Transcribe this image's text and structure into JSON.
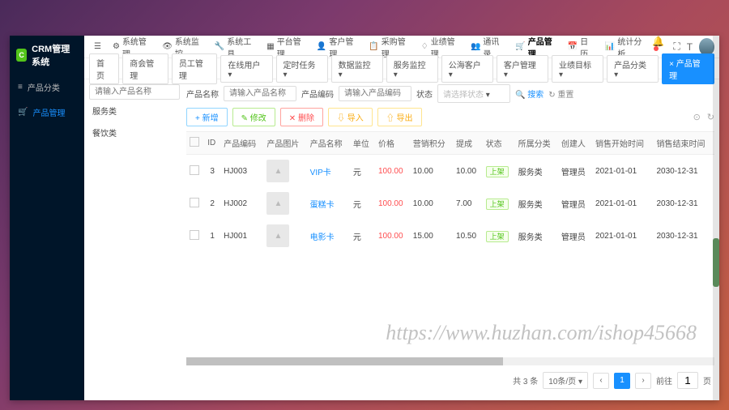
{
  "brand": {
    "title": "CRM管理系统",
    "badge": "C"
  },
  "sidebar": {
    "items": [
      {
        "icon": "list",
        "label": "产品分类"
      },
      {
        "icon": "cart",
        "label": "产品管理"
      }
    ]
  },
  "topnav": {
    "items": [
      {
        "label": "系统管理"
      },
      {
        "label": "系统监控"
      },
      {
        "label": "系统工具"
      },
      {
        "label": "平台管理"
      },
      {
        "label": "客户管理"
      },
      {
        "label": "采购管理"
      },
      {
        "label": "业绩管理"
      },
      {
        "label": "通讯录"
      },
      {
        "label": "产品管理",
        "current": true
      },
      {
        "label": "日历"
      },
      {
        "label": "统计分析"
      }
    ]
  },
  "tabs": {
    "items": [
      {
        "label": "首页"
      },
      {
        "label": "商会管理"
      },
      {
        "label": "员工管理"
      },
      {
        "label": "在线用户"
      },
      {
        "label": "定时任务"
      },
      {
        "label": "数据监控"
      },
      {
        "label": "服务监控"
      },
      {
        "label": "公海客户"
      },
      {
        "label": "客户管理"
      },
      {
        "label": "业绩目标"
      },
      {
        "label": "产品分类"
      },
      {
        "label": "× 产品管理",
        "primary": true
      }
    ]
  },
  "category": {
    "search_placeholder": "请输入产品名称",
    "items": [
      "服务类",
      "餐饮类"
    ]
  },
  "filters": {
    "name_label": "产品名称",
    "name_placeholder": "请输入产品名称",
    "code_label": "产品编码",
    "code_placeholder": "请输入产品编码",
    "status_label": "状态",
    "status_placeholder": "请选择状态",
    "search": "搜索",
    "reset": "重置"
  },
  "toolbar": {
    "add": "+ 新增",
    "edit": "✎ 修改",
    "del": "✕ 删除",
    "import": "⇩ 导入",
    "export": "⇧ 导出"
  },
  "table": {
    "headers": [
      "",
      "ID",
      "产品编码",
      "产品图片",
      "产品名称",
      "单位",
      "价格",
      "营销积分",
      "提成",
      "状态",
      "所属分类",
      "创建人",
      "销售开始时间",
      "销售结束时间"
    ],
    "rows": [
      {
        "id": "3",
        "code": "HJ003",
        "name": "VIP卡",
        "unit": "元",
        "price": "100.00",
        "points": "10.00",
        "commission": "10.00",
        "status": "上架",
        "category": "服务类",
        "creator": "管理员",
        "start": "2021-01-01",
        "end": "2030-12-31"
      },
      {
        "id": "2",
        "code": "HJ002",
        "name": "蛋糕卡",
        "unit": "元",
        "price": "100.00",
        "points": "10.00",
        "commission": "7.00",
        "status": "上架",
        "category": "服务类",
        "creator": "管理员",
        "start": "2021-01-01",
        "end": "2030-12-31"
      },
      {
        "id": "1",
        "code": "HJ001",
        "name": "电影卡",
        "unit": "元",
        "price": "100.00",
        "points": "15.00",
        "commission": "10.50",
        "status": "上架",
        "category": "服务类",
        "creator": "管理员",
        "start": "2021-01-01",
        "end": "2030-12-31"
      }
    ]
  },
  "pager": {
    "total": "共 3 条",
    "page_size": "10条/页",
    "current": "1",
    "goto_label": "前往",
    "goto_value": "1",
    "page_suffix": "页"
  },
  "watermark": "https://www.huzhan.com/ishop45668"
}
